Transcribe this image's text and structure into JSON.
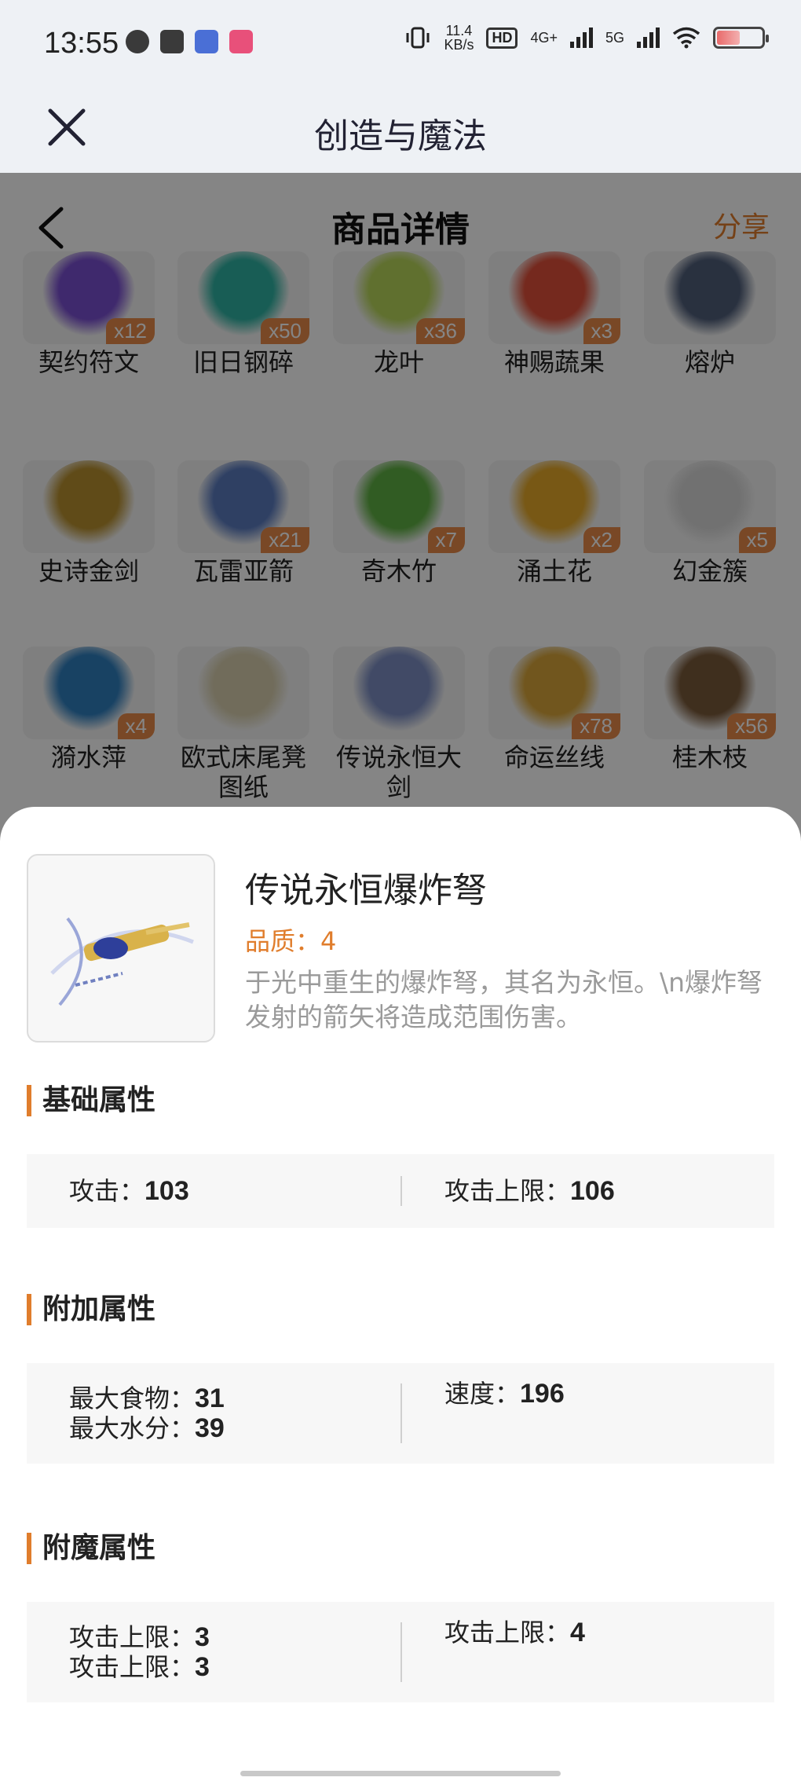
{
  "status_bar": {
    "time": "13:55",
    "net_speed_value": "11.4",
    "net_speed_unit": "KB/s",
    "hd_label": "HD",
    "signal_4g": "4G+",
    "signal_5g": "5G",
    "battery_level": 0.54
  },
  "app_bar": {
    "title": "创造与魔法"
  },
  "page": {
    "title": "商品详情",
    "share_label": "分享"
  },
  "items": [
    {
      "label": "契约符文",
      "count": "x12",
      "color": "#7a4fd1"
    },
    {
      "label": "旧日钢碎",
      "count": "x50",
      "color": "#2fb3a3"
    },
    {
      "label": "龙叶",
      "count": "x36",
      "color": "#b8d65a"
    },
    {
      "label": "神赐蔬果",
      "count": "x3",
      "color": "#e0503a"
    },
    {
      "label": "熔炉",
      "count": "",
      "color": "#4f5e7a"
    },
    {
      "label": "史诗金剑",
      "count": "",
      "color": "#b8902f"
    },
    {
      "label": "瓦雷亚箭",
      "count": "x21",
      "color": "#5a7bbf"
    },
    {
      "label": "奇木竹",
      "count": "x7",
      "color": "#5fb043"
    },
    {
      "label": "涌土花",
      "count": "x2",
      "color": "#e6a92a"
    },
    {
      "label": "幻金簇",
      "count": "x5",
      "color": "#d9d9d9"
    },
    {
      "label": "漪水萍",
      "count": "x4",
      "color": "#2f7fbf"
    },
    {
      "label": "欧式床尾凳图纸",
      "count": "",
      "color": "#d8cfae"
    },
    {
      "label": "传说永恒大剑",
      "count": "",
      "color": "#7d8fc4"
    },
    {
      "label": "命运丝线",
      "count": "x78",
      "color": "#d9a63a"
    },
    {
      "label": "桂木枝",
      "count": "x56",
      "color": "#7a5a3a"
    }
  ],
  "detail": {
    "name": "传说永恒爆炸弩",
    "quality": "品质：4",
    "description": "于光中重生的爆炸弩，其名为永恒。\\n爆炸弩发射的箭矢将造成范围伤害。"
  },
  "basic_section": {
    "title": "基础属性",
    "left": [
      {
        "label": "攻击：",
        "value": "103"
      }
    ],
    "right": [
      {
        "label": "攻击上限：",
        "value": "106"
      }
    ]
  },
  "extra_section": {
    "title": "附加属性",
    "left": [
      {
        "label": "最大食物：",
        "value": "31"
      },
      {
        "label": "最大水分：",
        "value": "39"
      }
    ],
    "right": [
      {
        "label": "速度：",
        "value": "196"
      }
    ]
  },
  "enchant_section": {
    "title": "附魔属性",
    "left": [
      {
        "label": "攻击上限：",
        "value": "3"
      },
      {
        "label": "攻击上限：",
        "value": "3"
      }
    ],
    "right": [
      {
        "label": "攻击上限：",
        "value": "4"
      }
    ]
  },
  "colors": {
    "accent": "#e07d2c",
    "badge": "#e88b4a"
  }
}
